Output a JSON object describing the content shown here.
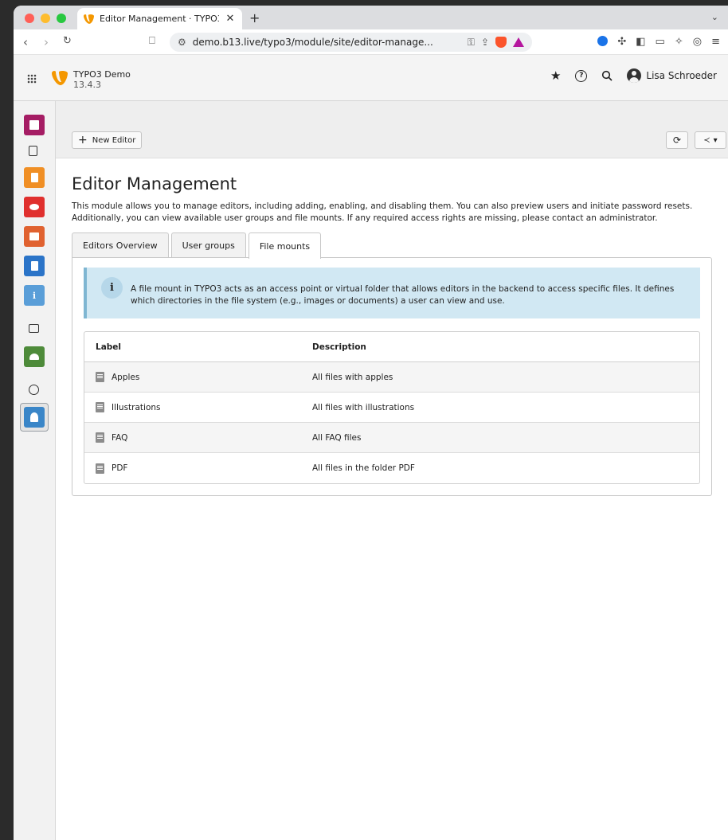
{
  "browser": {
    "tab_title": "Editor Management · TYPO3",
    "url": "demo.b13.live/typo3/module/site/editor-manage..."
  },
  "topbar": {
    "site_name": "TYPO3 Demo",
    "version": "13.4.3",
    "user_name": "Lisa Schroeder"
  },
  "sidebar": {
    "modules": [
      {
        "name": "web-layout",
        "color": "#a51d64"
      },
      {
        "name": "page",
        "color": ""
      },
      {
        "name": "list",
        "color": "#f08f25"
      },
      {
        "name": "view",
        "color": "#e0302e"
      },
      {
        "name": "list-records",
        "color": "#e06230"
      },
      {
        "name": "info",
        "color": "#2b74c8"
      },
      {
        "name": "info-i",
        "color": "#5a9ed8"
      },
      {
        "name": "filelist",
        "color": ""
      },
      {
        "name": "forms",
        "color": "#4e8b3a"
      },
      {
        "name": "sites",
        "color": ""
      },
      {
        "name": "editor-management",
        "color": "#3a86c8"
      }
    ]
  },
  "docheader": {
    "new_editor_label": "New Editor"
  },
  "module": {
    "title": "Editor Management",
    "intro": "This module allows you to manage editors, including adding, enabling, and disabling them. You can also preview users and initiate password resets. Additionally, you can view available user groups and file mounts. If any required access rights are missing, please contact an administrator.",
    "tabs": [
      {
        "label": "Editors Overview",
        "active": false
      },
      {
        "label": "User groups",
        "active": false
      },
      {
        "label": "File mounts",
        "active": true
      }
    ],
    "callout_icon": "i",
    "callout_text": "A file mount in TYPO3 acts as an access point or virtual folder that allows editors in the backend to access specific files. It defines which directories in the file system (e.g., images or documents) a user can view and use.",
    "table": {
      "headers": [
        "Label",
        "Description"
      ],
      "rows": [
        {
          "label": "Apples",
          "description": "All files with apples"
        },
        {
          "label": "Illustrations",
          "description": "All files with illustrations"
        },
        {
          "label": "FAQ",
          "description": "All FAQ files"
        },
        {
          "label": "PDF",
          "description": "All files in the folder PDF"
        }
      ]
    }
  }
}
